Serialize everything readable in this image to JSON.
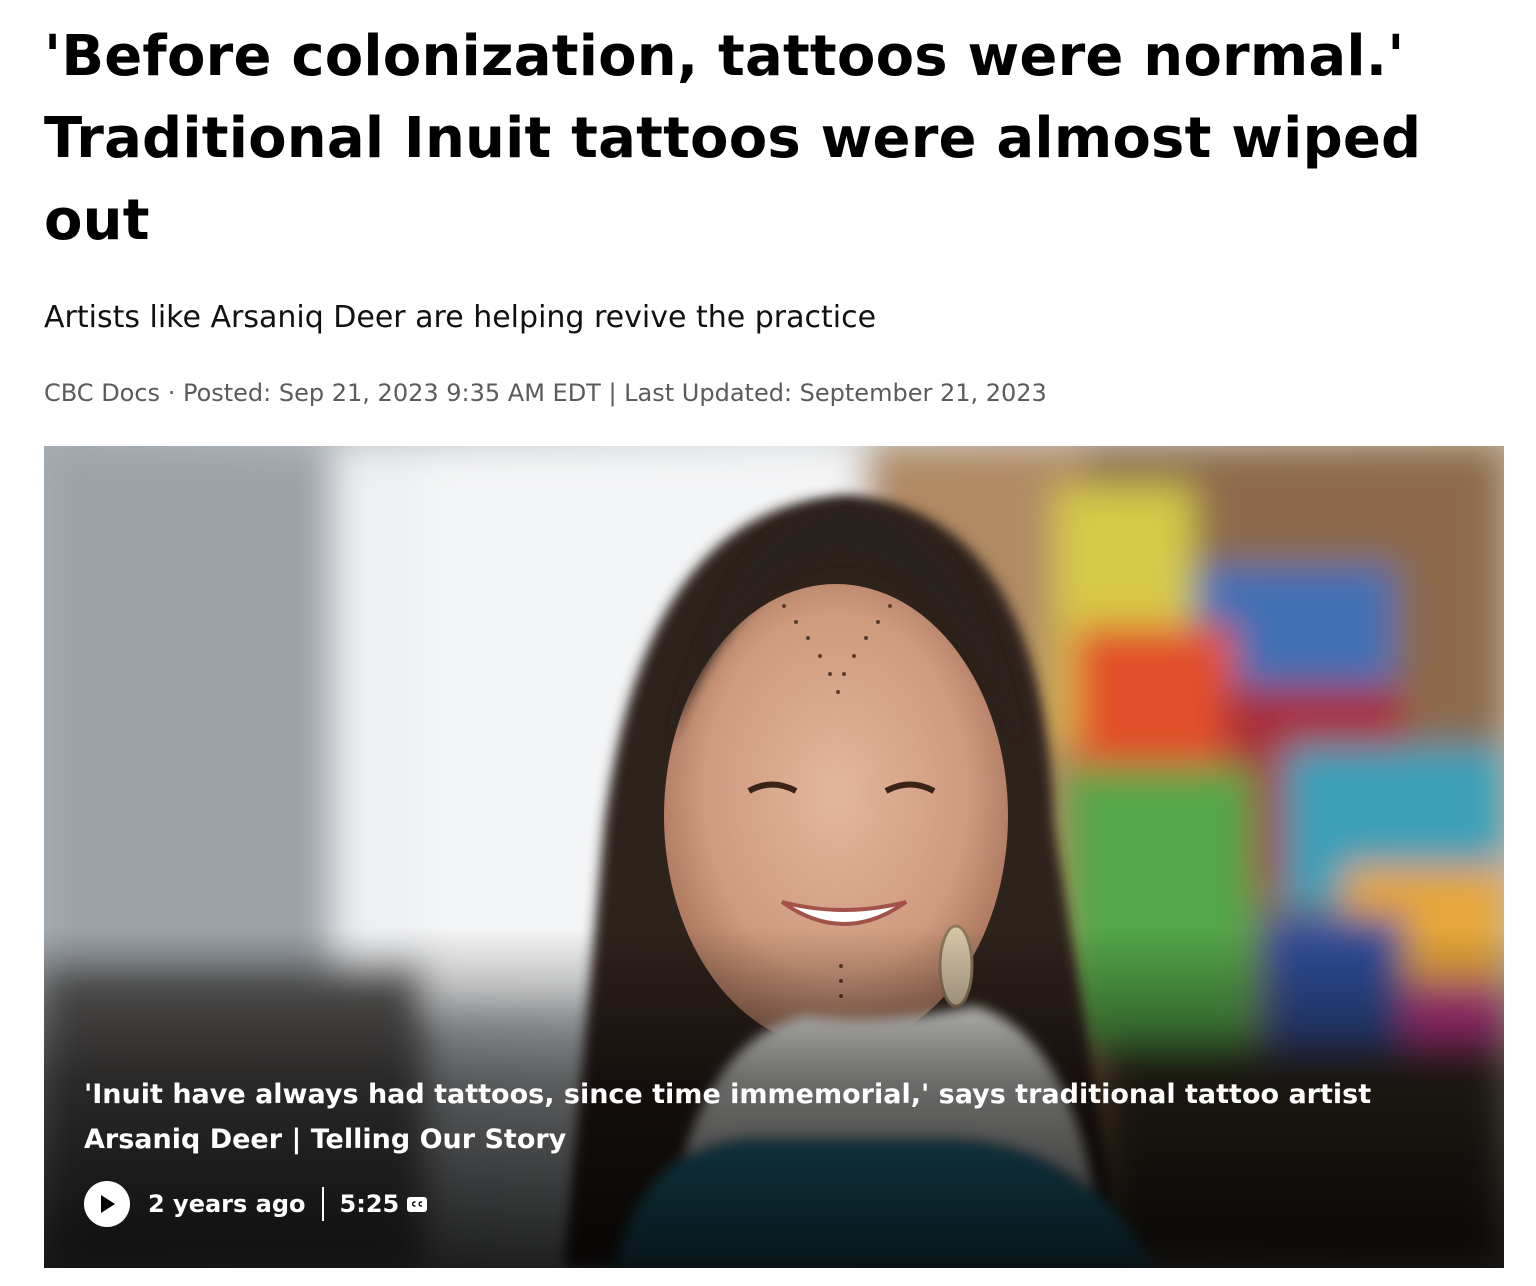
{
  "article": {
    "headline": "'Before colonization, tattoos were normal.' Traditional Inuit tattoos were almost wiped out",
    "deck": "Artists like Arsaniq Deer are helping revive the practice",
    "byline": {
      "source": "CBC Docs",
      "separator": " · ",
      "posted": "Posted: Sep 21, 2023 9:35 AM EDT | Last Updated: September 21, 2023"
    }
  },
  "video": {
    "caption": "'Inuit have always had tattoos, since time immemorial,' says traditional tattoo artist Arsaniq Deer | Telling Our Story",
    "age": "2 years ago",
    "duration": "5:25",
    "play_icon": "play-icon",
    "cc_icon": "closed-captions-icon"
  }
}
